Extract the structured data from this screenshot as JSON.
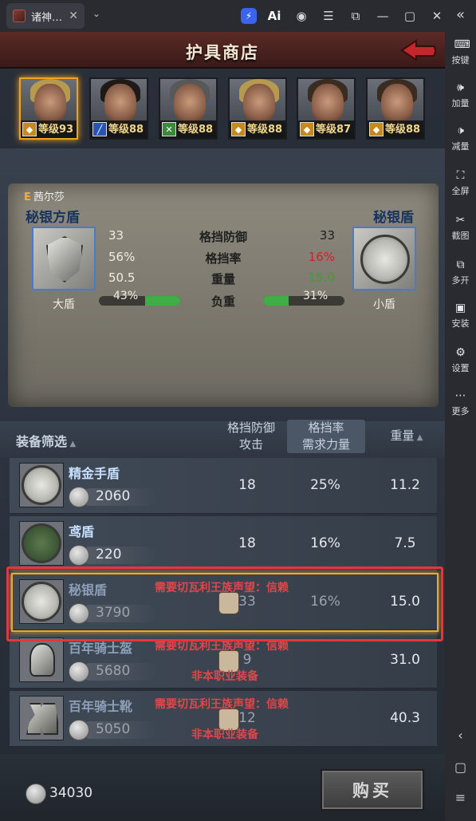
{
  "emulator": {
    "tab_title": "诸神…",
    "tab_close": "✕",
    "top_icons": [
      "bolt-icon",
      "ai-icon",
      "account-icon",
      "menu-icon",
      "popout-icon",
      "minimize-icon",
      "maximize-icon",
      "close-icon"
    ],
    "sidebar": [
      {
        "label": "按键",
        "icon": "keyboard-icon"
      },
      {
        "label": "加量",
        "icon": "volume-up-icon"
      },
      {
        "label": "减量",
        "icon": "volume-down-icon"
      },
      {
        "label": "全屏",
        "icon": "fullscreen-icon"
      },
      {
        "label": "截图",
        "icon": "screenshot-icon"
      },
      {
        "label": "多开",
        "icon": "multi-instance-icon"
      },
      {
        "label": "安装",
        "icon": "apk-install-icon"
      },
      {
        "label": "设置",
        "icon": "settings-icon"
      },
      {
        "label": "更多",
        "icon": "more-icon"
      }
    ]
  },
  "shop": {
    "title": "护具商店",
    "heroes": [
      {
        "level": "等级93",
        "class": "shield",
        "hair": "blonde",
        "selected": true
      },
      {
        "level": "等级88",
        "class": "blue",
        "hair": "dark",
        "selected": false
      },
      {
        "level": "等级88",
        "class": "green",
        "hair": "grey",
        "selected": false
      },
      {
        "level": "等级88",
        "class": "shield",
        "hair": "blonde",
        "selected": false
      },
      {
        "level": "等级87",
        "class": "shield",
        "hair": "brown",
        "selected": false
      },
      {
        "level": "等级88",
        "class": "shield",
        "hair": "brown",
        "selected": false
      }
    ],
    "compare": {
      "grade": "E",
      "hero_name": "茜尔莎",
      "left_item": "秘银方盾",
      "right_item": "秘银盾",
      "left_type": "大盾",
      "right_type": "小盾",
      "rows": [
        {
          "label": "格挡防御",
          "left": "33",
          "right": "33",
          "right_color": "normal"
        },
        {
          "label": "格挡率",
          "left": "56%",
          "right": "16%",
          "right_color": "red"
        },
        {
          "label": "重量",
          "left": "50.5",
          "right": "15.0",
          "right_color": "green"
        }
      ],
      "load": {
        "label": "负重",
        "left": "43%",
        "right": "31%",
        "left_value": 0.43,
        "right_value": 0.31
      }
    },
    "filter": {
      "label": "装备筛选",
      "col1_top": "格挡防御",
      "col1_bottom": "攻击",
      "col2_top": "格挡率",
      "col2_bottom": "需求力量",
      "col3": "重量"
    },
    "items": [
      {
        "name": "精金手盾",
        "price": "2060",
        "c1": "18",
        "c2": "25%",
        "c3": "11.2",
        "locked": false
      },
      {
        "name": "鸢盾",
        "price": "220",
        "c1": "18",
        "c2": "16%",
        "c3": "7.5",
        "locked": false
      },
      {
        "name": "秘银盾",
        "price": "3790",
        "c1": "33",
        "c2": "16%",
        "c3": "15.0",
        "locked": true,
        "req": "需要切瓦利王族声望：信赖",
        "req2": ""
      },
      {
        "name": "百年骑士盔",
        "price": "5680",
        "c1": "9",
        "c2": "",
        "c3": "31.0",
        "locked": true,
        "req": "需要切瓦利王族声望：信赖",
        "req2": "非本职业装备"
      },
      {
        "name": "百年骑士靴",
        "price": "5050",
        "c1": "12",
        "c2": "",
        "c3": "40.3",
        "locked": true,
        "req": "需要切瓦利王族声望：信赖",
        "req2": "非本职业装备"
      }
    ],
    "balance": "34030",
    "buy_label": "购买"
  }
}
